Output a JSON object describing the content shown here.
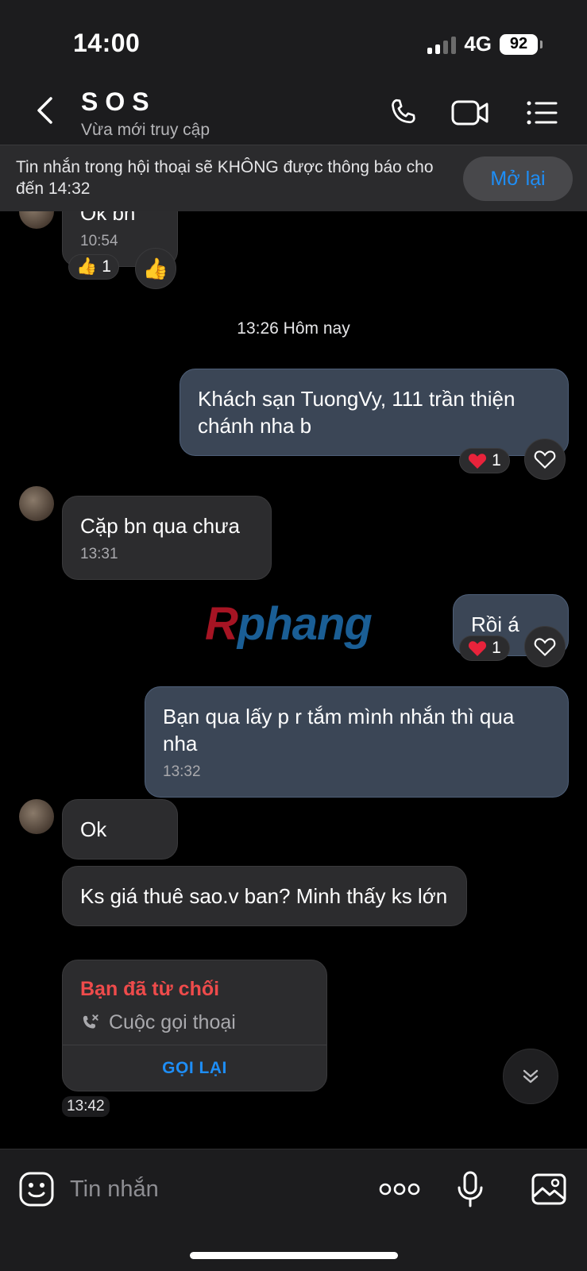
{
  "status_bar": {
    "time": "14:00",
    "network": "4G",
    "battery": "92"
  },
  "header": {
    "title": "SOS",
    "subtitle": "Vừa mới truy cập"
  },
  "banner": {
    "text": "Tin nhắn trong hội thoại sẽ KHÔNG được thông báo cho đến 14:32",
    "button": "Mở lại"
  },
  "messages": {
    "m0": {
      "text": "Ok bn",
      "time": "10:54",
      "reaction_count": "1"
    },
    "day_separator": "13:26 Hôm nay",
    "m1": {
      "text": "Khách sạn TuongVy, 111 trần thiện chánh nha b",
      "reaction_count": "1"
    },
    "m2": {
      "text": "Cặp bn qua chưa",
      "time": "13:31"
    },
    "m3": {
      "text": "Rồi á",
      "reaction_count": "1"
    },
    "m4": {
      "text": "Bạn qua lấy p r tắm mình nhắn thì qua nha",
      "time": "13:32"
    },
    "m5": {
      "text": "Ok"
    },
    "m6": {
      "text": "Ks giá thuê sao.v ban? Minh thấy ks lớn"
    },
    "call": {
      "title": "Bạn đã từ chối",
      "type": "Cuộc gọi thoại",
      "action": "GỌI LẠI",
      "time": "13:42"
    }
  },
  "watermark": {
    "prefix": "R",
    "rest": "phang"
  },
  "input": {
    "placeholder": "Tin nhắn"
  },
  "colors": {
    "accent": "#1e8ef7",
    "declined": "#ef4b4b",
    "outgoing_bubble": "#3b4656",
    "incoming_bubble": "#2c2c2e"
  },
  "icons": [
    "back-icon",
    "phone-icon",
    "video-icon",
    "menu-icon",
    "thumbs-up-icon",
    "heart-icon",
    "heart-outline-icon",
    "phone-declined-icon",
    "chevron-double-down-icon",
    "sticker-icon",
    "more-icon",
    "microphone-icon",
    "image-icon"
  ]
}
